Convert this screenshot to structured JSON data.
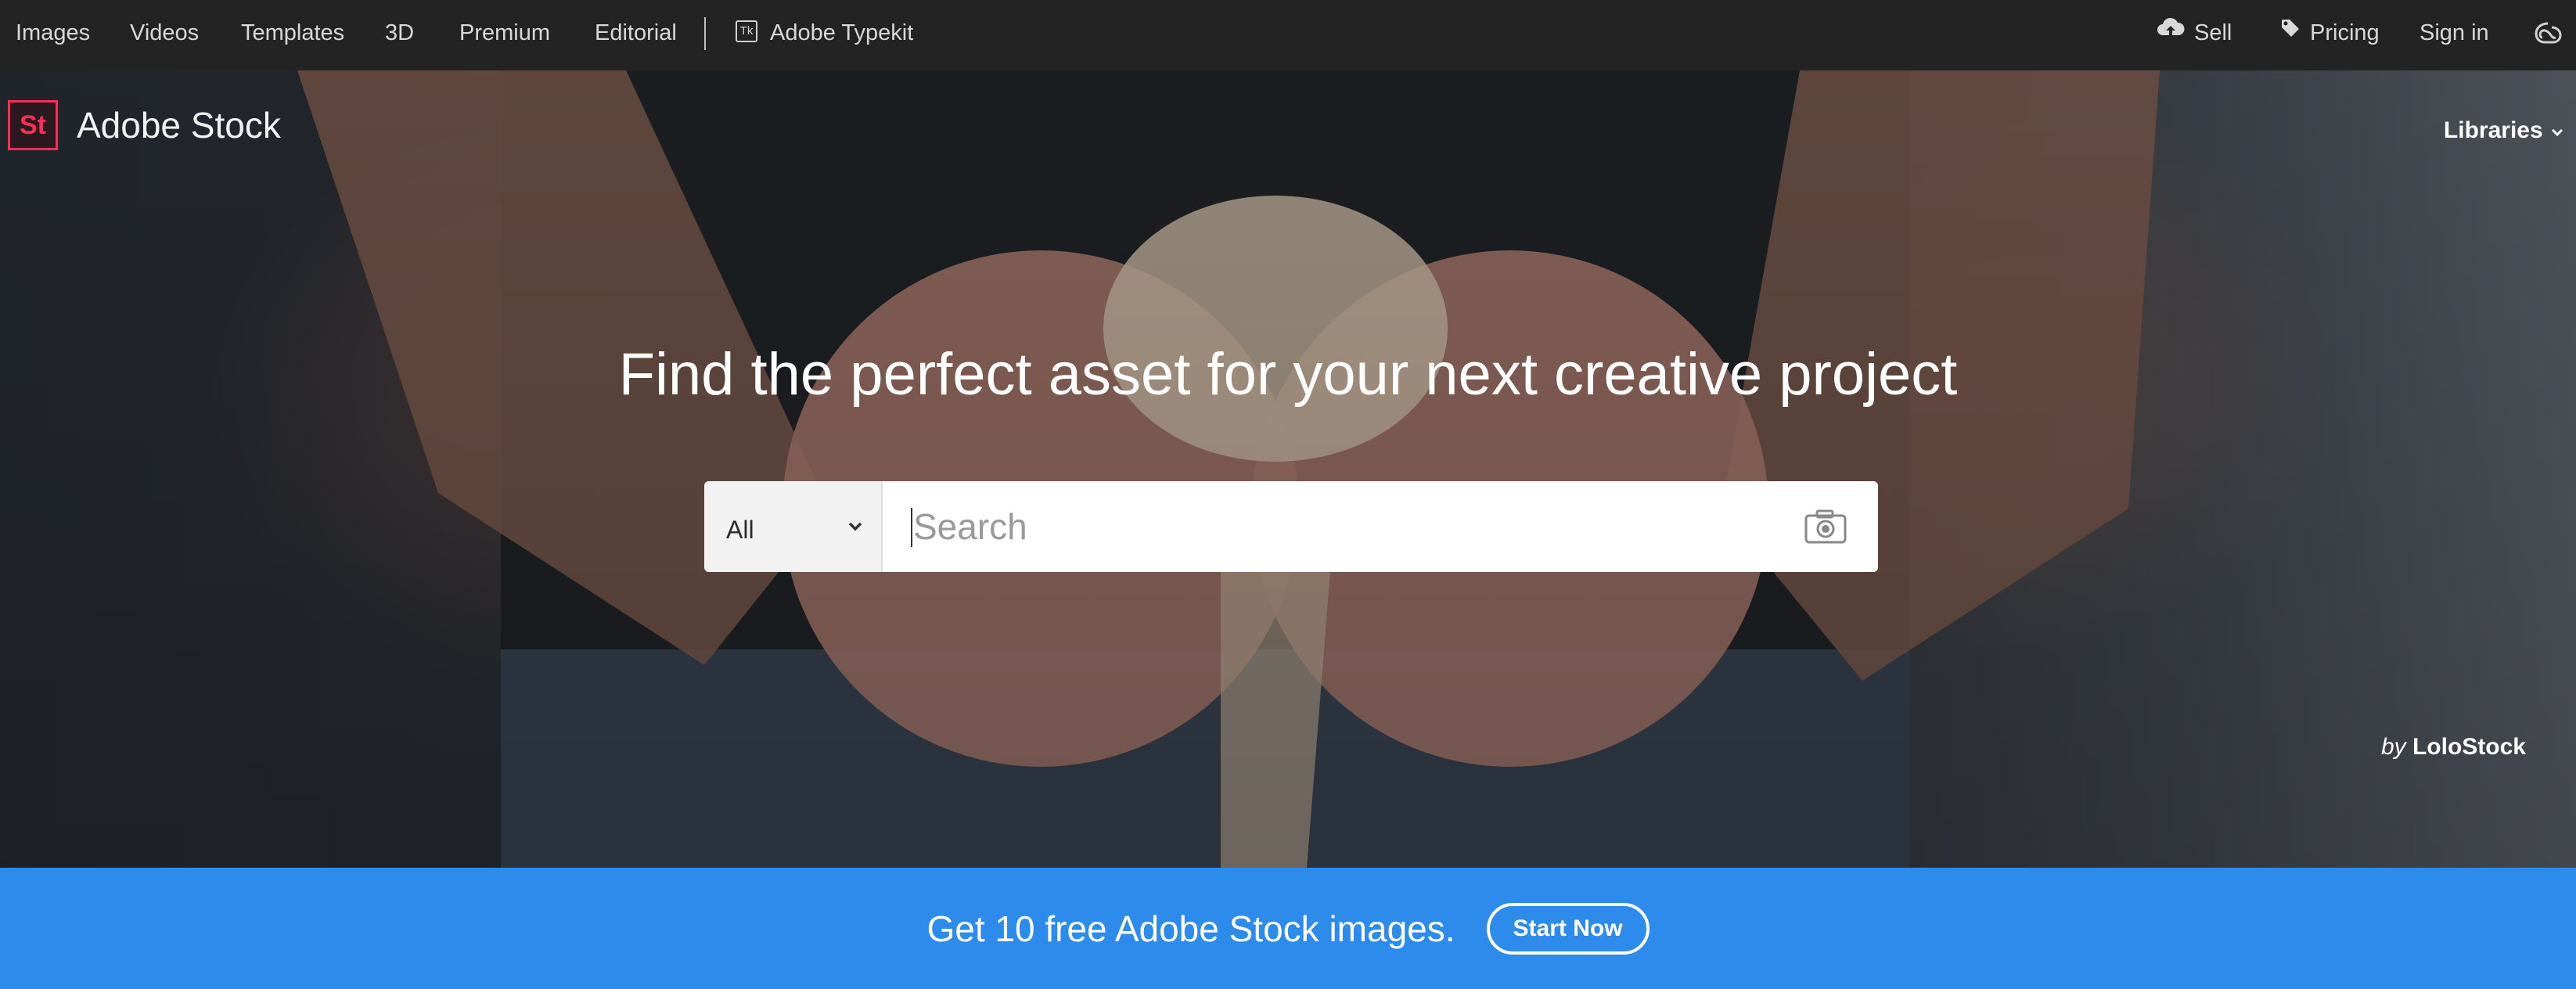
{
  "topnav": {
    "items": [
      "Images",
      "Videos",
      "Templates",
      "3D",
      "Premium",
      "Editorial"
    ],
    "typekit_badge": "Tk",
    "typekit_label": "Adobe Typekit",
    "sell_label": "Sell",
    "pricing_label": "Pricing",
    "signin_label": "Sign in"
  },
  "brand": {
    "logo_mark": "St",
    "name": "Adobe Stock",
    "accent_color": "#ff2d55"
  },
  "header": {
    "libraries_label": "Libraries"
  },
  "hero": {
    "headline": "Find the perfect asset for your next creative project",
    "search": {
      "category_value": "All",
      "placeholder": "Search",
      "camera_icon": "camera-icon"
    },
    "credit_by": "by",
    "credit_name": "LoloStock"
  },
  "banner": {
    "text": "Get 10 free Adobe Stock images.",
    "button_label": "Start Now",
    "color": "#2d8ceb"
  }
}
